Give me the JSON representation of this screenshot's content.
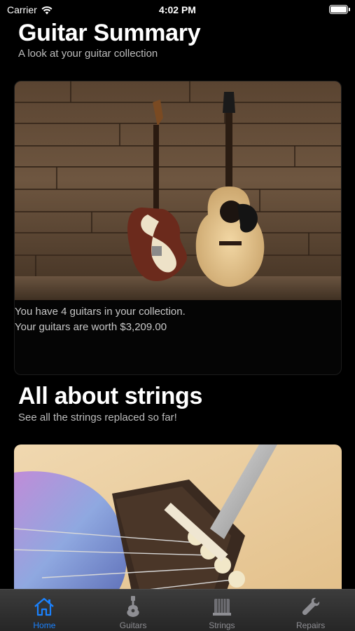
{
  "status_bar": {
    "carrier": "Carrier",
    "time": "4:02 PM"
  },
  "summary": {
    "title": "Guitar Summary",
    "subtitle": "A look at your guitar collection",
    "count_text": "You have 4 guitars in your collection.",
    "worth_text": "Your guitars are worth $3,209.00"
  },
  "strings": {
    "title": "All about strings",
    "subtitle": "See all the strings replaced so far!"
  },
  "tab_bar": {
    "tabs": [
      {
        "label": "Home",
        "icon": "house-icon",
        "active": true
      },
      {
        "label": "Guitars",
        "icon": "guitar-icon",
        "active": false
      },
      {
        "label": "Strings",
        "icon": "strings-icon",
        "active": false
      },
      {
        "label": "Repairs",
        "icon": "wrench-icon",
        "active": false
      }
    ]
  },
  "colors": {
    "accent": "#1a82ff",
    "background": "#000000",
    "tab_inactive": "#8e8e93"
  }
}
